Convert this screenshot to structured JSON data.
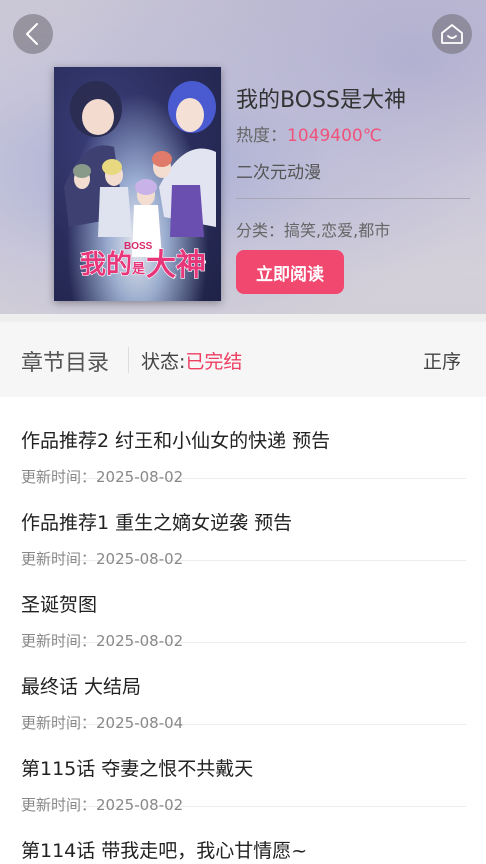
{
  "header": {
    "back_icon": "chevron-left-icon",
    "home_icon": "home-icon"
  },
  "comic": {
    "title": "我的BOSS是大神",
    "heat_label": "热度：",
    "heat_value": "1049400℃",
    "genre": "二次元动漫",
    "category_label": "分类：",
    "category_value": "搞笑,恋爱,都市",
    "read_button": "立即阅读",
    "cover_logo_text": "我的BOSS是大神"
  },
  "toc": {
    "title": "章节目录",
    "status_label": "状态:",
    "status_value": "已完结",
    "order_label": "正序"
  },
  "chapters": [
    {
      "name": "作品推荐2 纣王和小仙女的快递 预告",
      "time_label": "更新时间：",
      "time": "2025-08-02"
    },
    {
      "name": "作品推荐1 重生之嫡女逆袭 预告",
      "time_label": "更新时间：",
      "time": "2025-08-02"
    },
    {
      "name": "圣诞贺图",
      "time_label": "更新时间：",
      "time": "2025-08-02"
    },
    {
      "name": "最终话 大结局",
      "time_label": "更新时间：",
      "time": "2025-08-04"
    },
    {
      "name": "第115话 夺妻之恨不共戴天",
      "time_label": "更新时间：",
      "time": "2025-08-02"
    },
    {
      "name": "第114话 带我走吧，我心甘情愿~",
      "time_label": "",
      "time": ""
    }
  ],
  "colors": {
    "accent": "#f0486e",
    "status_done": "#ee3e62",
    "heat_value": "#f0537a"
  }
}
